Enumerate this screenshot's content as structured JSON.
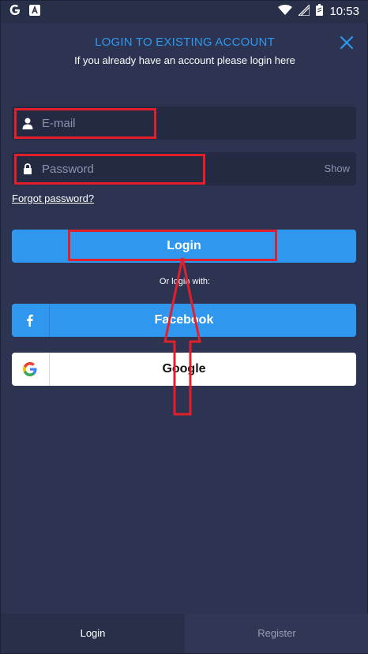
{
  "status_bar": {
    "time": "10:53",
    "left_icons": [
      "google-icon",
      "notification-a-icon"
    ],
    "right_icons": [
      "wifi-icon",
      "signal-icon",
      "battery-icon"
    ]
  },
  "header": {
    "title": "LOGIN TO EXISTING ACCOUNT",
    "subtitle": "If you already have an account please login here",
    "close_icon": "close-icon"
  },
  "form": {
    "email_placeholder": "E-mail",
    "email_value": "",
    "password_placeholder": "Password",
    "password_value": "",
    "show_label": "Show",
    "forgot_label": "Forgot password?",
    "login_label": "Login"
  },
  "social": {
    "or_text": "Or login with:",
    "facebook_label": "Facebook",
    "google_label": "Google"
  },
  "tabs": [
    {
      "label": "Login",
      "active": true
    },
    {
      "label": "Register",
      "active": false
    }
  ],
  "colors": {
    "background": "#2c3452",
    "accent": "#2f97ee",
    "field_bg": "#232a41",
    "highlight": "#e2202b"
  }
}
